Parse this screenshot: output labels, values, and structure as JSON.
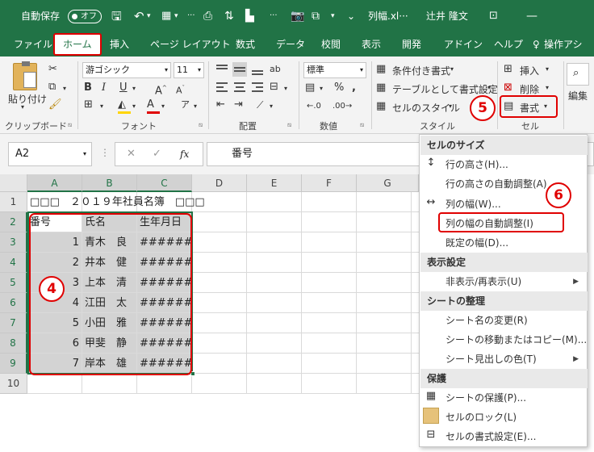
{
  "titlebar": {
    "autosave_label": "自動保存",
    "autosave_state": "オフ",
    "file_name": "列幅.xl···",
    "user_name": "辻井 隆文"
  },
  "tabs": [
    "ファイル",
    "ホーム",
    "挿入",
    "ページ レイアウト",
    "数式",
    "データ",
    "校閲",
    "表示",
    "開発",
    "アドイン",
    "ヘルプ",
    "操作アシ"
  ],
  "ribbon": {
    "paste_label": "貼り付け",
    "font_name": "游ゴシック",
    "font_size": "11",
    "number_format": "標準",
    "conditional_format": "条件付き書式",
    "table_format": "テーブルとして書式設定",
    "cell_style": "セルのスタイル",
    "insert": "挿入",
    "delete": "削除",
    "format": "書式",
    "edit": "編集",
    "groups": {
      "clipboard": "クリップボード",
      "font": "フォント",
      "alignment": "配置",
      "number": "数値",
      "style": "スタイル",
      "cells": "セル"
    }
  },
  "formula_bar": {
    "name_box": "A2",
    "formula": "番号"
  },
  "grid": {
    "columns": [
      "A",
      "B",
      "C",
      "D",
      "E",
      "F",
      "G"
    ],
    "rows": [
      "1",
      "2",
      "3",
      "4",
      "5",
      "6",
      "7",
      "8",
      "9",
      "10"
    ],
    "title_row": "□□□　２０１９年社員名簿　□□□",
    "header": [
      "番号",
      "氏名",
      "生年月日"
    ],
    "data": [
      [
        "1",
        "青木　良",
        "#######"
      ],
      [
        "2",
        "井本　健",
        "#######"
      ],
      [
        "3",
        "上本　清",
        "#######"
      ],
      [
        "4",
        "江田　太",
        "#######"
      ],
      [
        "5",
        "小田　雅",
        "#######"
      ],
      [
        "6",
        "甲斐　静",
        "#######"
      ],
      [
        "7",
        "岸本　雄",
        "#######"
      ]
    ]
  },
  "menu": {
    "cell_size_header": "セルのサイズ",
    "row_height": "行の高さ(H)...",
    "row_autofit": "行の高さの自動調整(A)",
    "col_width": "列の幅(W)...",
    "col_autofit": "列の幅の自動調整(I)",
    "default_width": "既定の幅(D)...",
    "visibility_header": "表示設定",
    "hide_unhide": "非表示/再表示(U)",
    "organize_header": "シートの整理",
    "rename_sheet": "シート名の変更(R)",
    "move_copy_sheet": "シートの移動またはコピー(M)...",
    "tab_color": "シート見出しの色(T)",
    "protection_header": "保護",
    "protect_sheet": "シートの保護(P)...",
    "lock_cell": "セルのロック(L)",
    "format_cells": "セルの書式設定(E)..."
  },
  "callouts": [
    "4",
    "5",
    "6"
  ]
}
